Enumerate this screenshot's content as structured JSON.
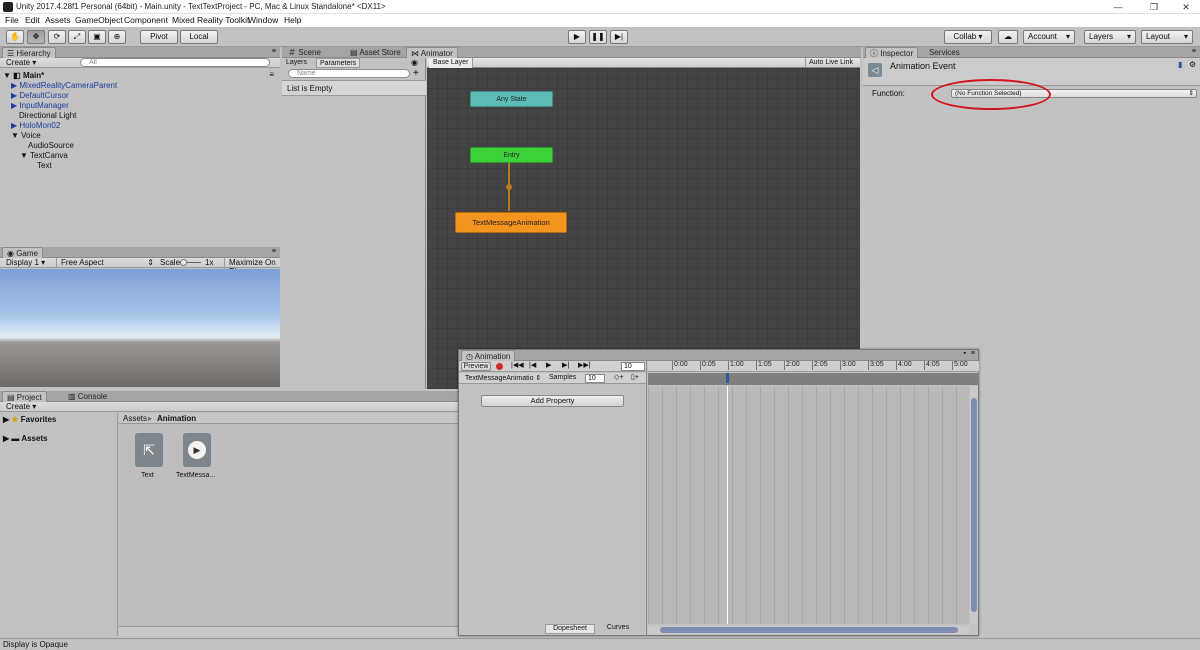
{
  "window": {
    "title": "Unity 2017.4.28f1 Personal (64bit) - Main.unity - TextTextProject - PC, Mac & Linux Standalone* <DX11>",
    "minimize": "—",
    "maximize": "❐",
    "close": "✕"
  },
  "menu": [
    "File",
    "Edit",
    "Assets",
    "GameObject",
    "Component",
    "Mixed Reality Toolkit",
    "Window",
    "Help"
  ],
  "toolbar": {
    "pivot": "Pivot",
    "local": "Local",
    "collab": "Collab ▾",
    "account": "Account",
    "layers": "Layers",
    "layout": "Layout"
  },
  "hierarchy": {
    "tab": "Hierarchy",
    "create": "Create",
    "search_placeholder": "All",
    "scene": "Main*",
    "items": [
      {
        "label": "MixedRealityCameraParent",
        "arrow": "▶",
        "blue": true
      },
      {
        "label": "DefaultCursor",
        "arrow": "▶",
        "blue": true
      },
      {
        "label": "InputManager",
        "arrow": "▶",
        "blue": true
      },
      {
        "label": "Directional Light",
        "arrow": "",
        "blue": false
      },
      {
        "label": "HoloMon02",
        "arrow": "▶",
        "blue": true
      },
      {
        "label": "Voice",
        "arrow": "▼",
        "blue": false
      },
      {
        "label": "AudioSource",
        "arrow": "",
        "blue": false
      },
      {
        "label": "TextCanva",
        "arrow": "▼",
        "blue": false
      },
      {
        "label": "Text",
        "arrow": "",
        "blue": false
      }
    ]
  },
  "game": {
    "tab": "Game",
    "display": "Display 1",
    "aspect": "Free Aspect",
    "scale_label": "Scale",
    "scale_value": "1x",
    "maximize": "Maximize On Pla"
  },
  "center_tabs": {
    "scene": "Scene",
    "asset_store": "Asset Store",
    "animator": "Animator"
  },
  "animator": {
    "left_tabs": {
      "layers": "Layers",
      "parameters": "Parameters"
    },
    "name_placeholder": "Name",
    "list_empty": "List is Empty",
    "base_layer": "Base Layer",
    "auto_live_link": "Auto Live Link",
    "nodes": {
      "any_state": "Any State",
      "entry": "Entry",
      "text_anim": "TextMessageAnimation"
    }
  },
  "inspector": {
    "tab": "Inspector",
    "services_tab": "Services",
    "header": "Animation Event",
    "function_label": "Function:",
    "function_value": "(No Function Selected)"
  },
  "project": {
    "tab": "Project",
    "console_tab": "Console",
    "create": "Create",
    "favorites": "Favorites",
    "assets": "Assets",
    "breadcrumb_root": "Assets",
    "breadcrumb_sep": "▸",
    "breadcrumb_leaf": "Animation",
    "files": [
      {
        "name": "Text",
        "icon": "animator-controller-icon"
      },
      {
        "name": "TextMessa...",
        "icon": "animation-clip-icon"
      }
    ]
  },
  "animation": {
    "tab": "Animation",
    "preview": "Preview",
    "frame": "10",
    "clip": "TextMessageAnimatio",
    "samples_label": "Samples",
    "samples_value": "10",
    "add_property": "Add Property",
    "dopesheet": "Dopesheet",
    "curves": "Curves",
    "ticks": [
      "0:00",
      "0:05",
      "1:00",
      "1:05",
      "2:00",
      "2:05",
      "3:00",
      "3:05",
      "4:00",
      "4:05",
      "5:00"
    ]
  },
  "status": "Display is Opaque"
}
